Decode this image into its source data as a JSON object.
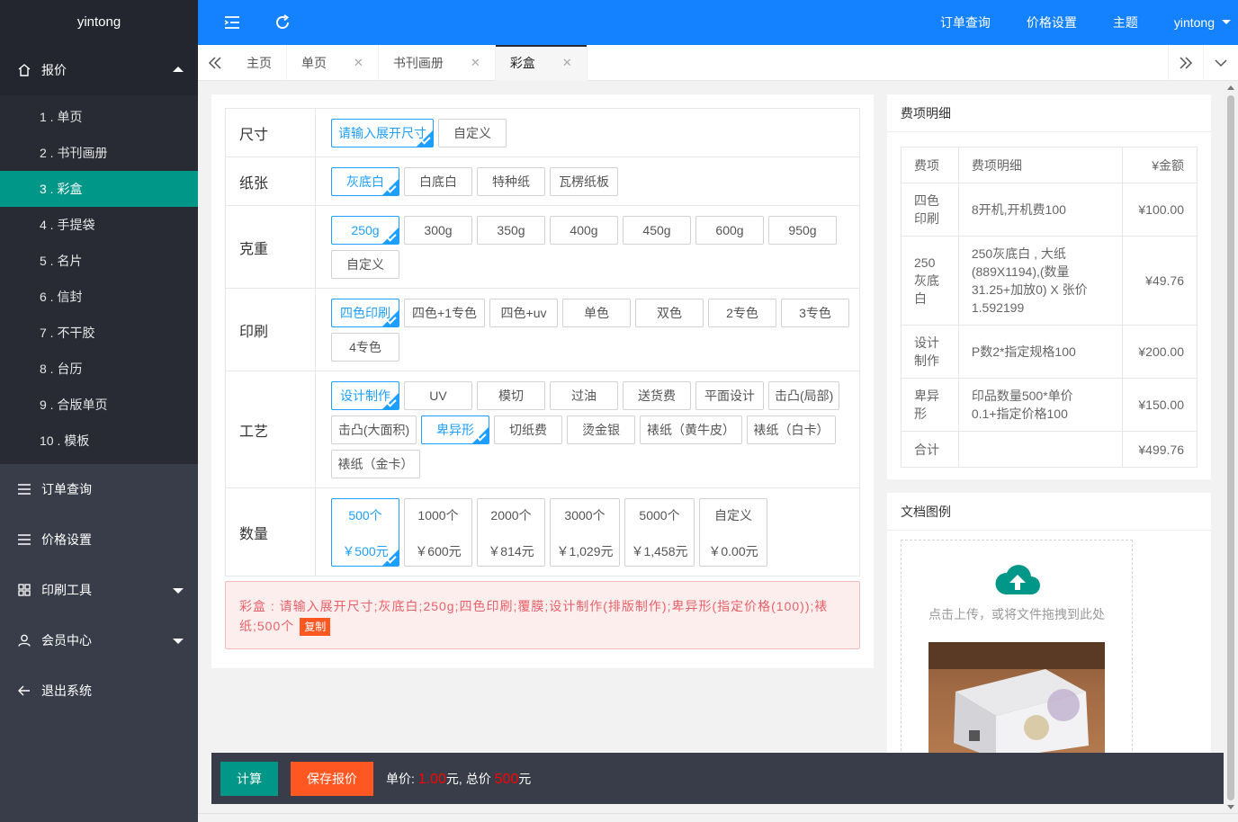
{
  "brand": "yintong",
  "sidebar": {
    "quote_group": "报价",
    "quote_items": [
      "1 . 单页",
      "2 . 书刊画册",
      "3 . 彩盒",
      "4 . 手提袋",
      "5 . 名片",
      "6 . 信封",
      "7 . 不干胶",
      "8 . 台历",
      "9 . 合版单页",
      "10 . 模板"
    ],
    "groups": {
      "orders": "订单查询",
      "pricing": "价格设置",
      "tools": "印刷工具",
      "member": "会员中心",
      "logout": "退出系统"
    }
  },
  "header": {
    "nav": [
      "订单查询",
      "价格设置",
      "主题"
    ],
    "user": "yintong"
  },
  "tabs": [
    {
      "label": "主页",
      "closable": false
    },
    {
      "label": "单页",
      "closable": true
    },
    {
      "label": "书刊画册",
      "closable": true
    },
    {
      "label": "彩盒",
      "closable": true
    }
  ],
  "options": {
    "size": {
      "label": "尺寸",
      "items": [
        "请输入展开尺寸",
        "自定义"
      ]
    },
    "paper": {
      "label": "纸张",
      "items": [
        "灰底白",
        "白底白",
        "特种纸",
        "瓦楞纸板"
      ]
    },
    "weight": {
      "label": "克重",
      "items": [
        "250g",
        "300g",
        "350g",
        "400g",
        "450g",
        "600g",
        "950g",
        "自定义"
      ]
    },
    "print": {
      "label": "印刷",
      "items": [
        "四色印刷",
        "四色+1专色",
        "四色+uv",
        "单色",
        "双色",
        "2专色",
        "3专色",
        "4专色"
      ]
    },
    "craft": {
      "label": "工艺",
      "items": [
        "设计制作",
        "UV",
        "模切",
        "过油",
        "送货费",
        "平面设计",
        "击凸(局部)",
        "击凸(大面积)",
        "卑异形",
        "切纸费",
        "烫金银",
        "裱纸（黄牛皮）",
        "裱纸（白卡）",
        "裱纸（金卡）"
      ]
    },
    "qty": {
      "label": "数量",
      "items": [
        {
          "n": "500个",
          "p": "￥500元"
        },
        {
          "n": "1000个",
          "p": "￥600元"
        },
        {
          "n": "2000个",
          "p": "￥814元"
        },
        {
          "n": "3000个",
          "p": "￥1,029元"
        },
        {
          "n": "5000个",
          "p": "￥1,458元"
        },
        {
          "n": "自定义",
          "p": "￥0.00元"
        }
      ]
    }
  },
  "summary": {
    "text": "彩盒 : 请输入展开尺寸;灰底白;250g;四色印刷;覆膜;设计制作(排版制作);卑异形(指定价格(100));裱纸;500个",
    "copy": "复制"
  },
  "fee": {
    "title": "费项明细",
    "headers": [
      "费项",
      "费项明细",
      "¥金额"
    ],
    "rows": [
      [
        "四色印刷",
        "8开机,开机费100",
        "¥100.00"
      ],
      [
        "250灰底白",
        "250灰底白 , 大纸(889X1194),(数量31.25+加放0) X 张价1.592199",
        "¥49.76"
      ],
      [
        "设计制作",
        "P数2*指定规格100",
        "¥200.00"
      ],
      [
        "卑异形",
        "印品数量500*单价0.1+指定价格100",
        "¥150.00"
      ],
      [
        "合计",
        "",
        "¥499.76"
      ]
    ]
  },
  "doc": {
    "title": "文档图例",
    "upload_text": "点击上传，或将文件拖拽到此处"
  },
  "footer": {
    "calc": "计算",
    "save": "保存报价",
    "unit_label": "单价:",
    "unit_value": "1.00",
    "unit_suffix": "元, 总价",
    "total_value": "500",
    "total_suffix": "元"
  },
  "colors": {
    "header": "#1481ff",
    "accent": "#009688",
    "selected": "#1e9fff",
    "danger": "#ff5722"
  }
}
